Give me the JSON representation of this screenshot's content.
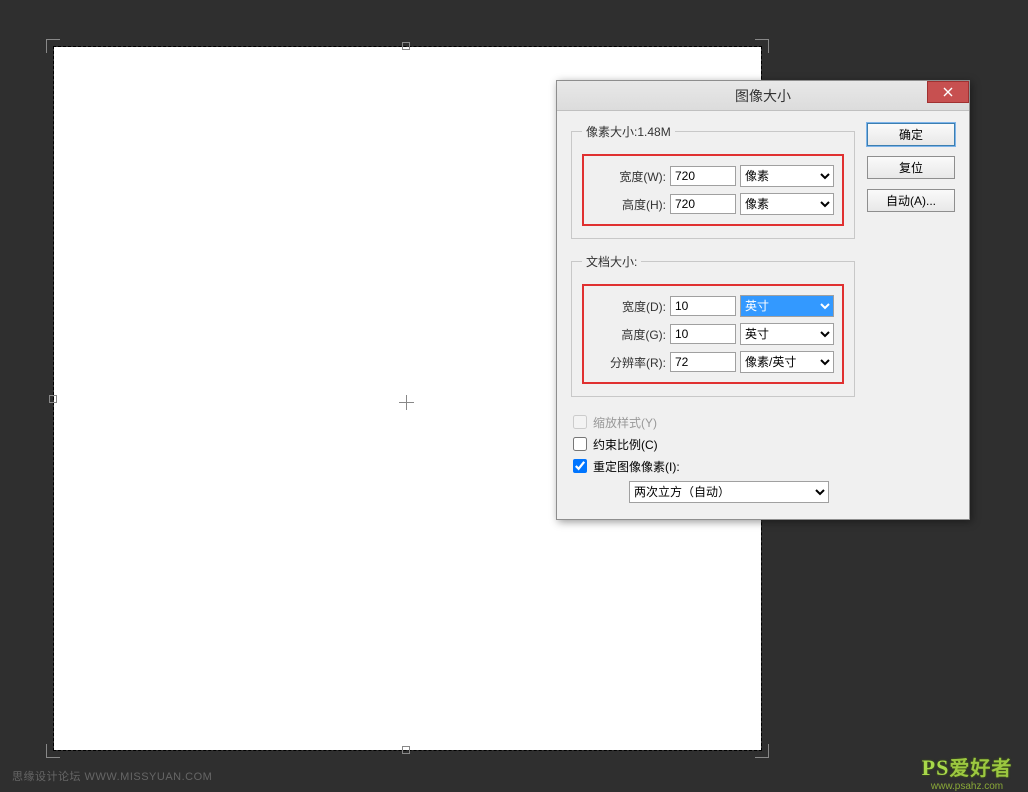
{
  "dialog": {
    "title": "图像大小",
    "pixel_section": {
      "legend": "像素大小:1.48M",
      "width_label": "宽度(W):",
      "width_value": "720",
      "width_unit": "像素",
      "height_label": "高度(H):",
      "height_value": "720",
      "height_unit": "像素"
    },
    "doc_section": {
      "legend": "文档大小:",
      "width_label": "宽度(D):",
      "width_value": "10",
      "width_unit": "英寸",
      "height_label": "高度(G):",
      "height_value": "10",
      "height_unit": "英寸",
      "res_label": "分辨率(R):",
      "res_value": "72",
      "res_unit": "像素/英寸"
    },
    "scale_styles_label": "缩放样式(Y)",
    "constrain_label": "约束比例(C)",
    "resample_label": "重定图像像素(I):",
    "resample_method": "两次立方（自动）",
    "buttons": {
      "ok": "确定",
      "reset": "复位",
      "auto": "自动(A)..."
    }
  },
  "watermark": {
    "left": "思缘设计论坛 WWW.MISSYUAN.COM",
    "right_logo_en": "PS",
    "right_logo_cn": "爱好者",
    "right_url": "www.psahz.com"
  }
}
